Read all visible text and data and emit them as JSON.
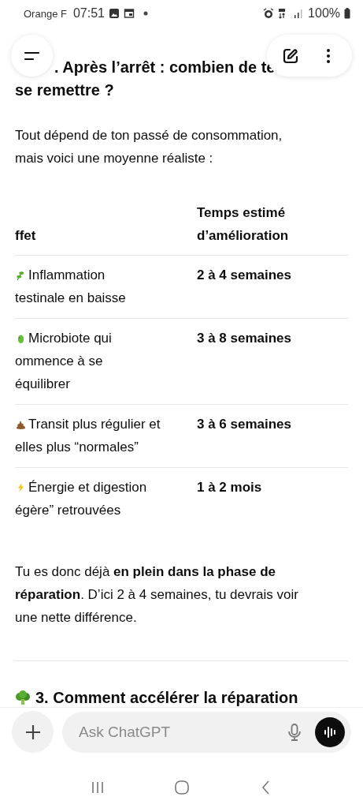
{
  "status_bar": {
    "carrier": "Orange F",
    "time": "07:51",
    "battery": "100%"
  },
  "title": {
    "line_1": ". Après l’arrêt : combien de te",
    "line_2": "se remettre ?"
  },
  "intro": "Tout dépend de ton passé de consommation, mais voici une moyenne réaliste :",
  "table": {
    "columns": [
      "ffet",
      "Temps estimé d’amélioration"
    ],
    "rows": [
      {
        "effect": [
          "Inflammation",
          "testinale en baisse"
        ],
        "time": "2 à 4 semaines"
      },
      {
        "effect": [
          "Microbiote qui",
          "ommence à se",
          "équilibrer"
        ],
        "time": "3 à 8 semaines"
      },
      {
        "effect": [
          "Transit plus régulier et",
          "elles plus “normales”"
        ],
        "time": "3 à 6 semaines"
      },
      {
        "effect": [
          "Énergie et digestion",
          "égère” retrouvées"
        ],
        "time": "1 à 2 mois"
      }
    ]
  },
  "conclusion": "Tu es donc déjà **en plein dans la phase de réparation**. D’ici 2 à 4 semaines, tu devrais voir une nette différence.",
  "next_heading": "3. Comment accélérer la réparation",
  "composer": {
    "placeholder": "Ask ChatGPT"
  }
}
